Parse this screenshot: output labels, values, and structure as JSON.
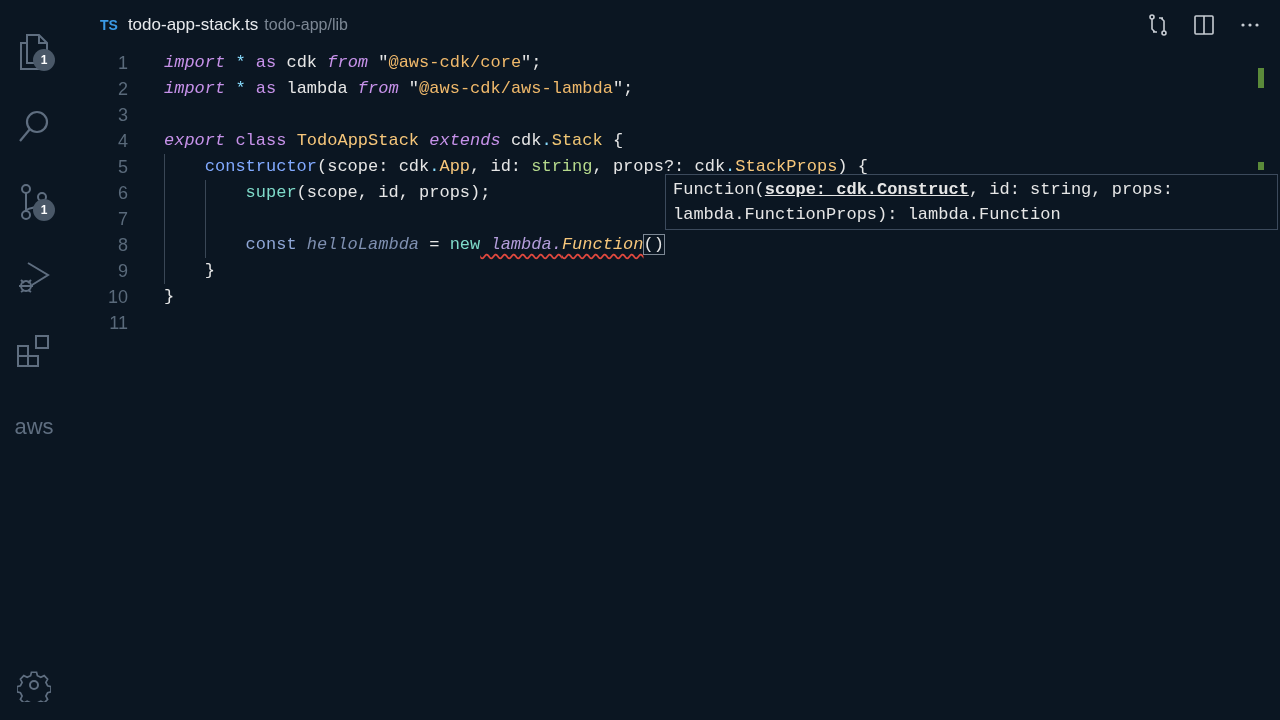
{
  "activity_bar": {
    "items": [
      {
        "kind": "files",
        "badge": "1"
      },
      {
        "kind": "search"
      },
      {
        "kind": "branch",
        "badge": "1"
      },
      {
        "kind": "debug"
      },
      {
        "kind": "extensions"
      },
      {
        "kind": "logo",
        "label": "aws"
      }
    ]
  },
  "editor_header": {
    "file_type": "TS",
    "file_name": "todo-app-stack.ts",
    "path": "todo-app/lib"
  },
  "code_lines": [
    {
      "number": "1",
      "tokens": [
        {
          "kind": "keyword-italic",
          "text": "import"
        },
        {
          "kind": "operator",
          "text": " *"
        },
        {
          "kind": "keyword",
          "text": " as"
        },
        {
          "kind": "plain",
          "text": " cdk "
        },
        {
          "kind": "keyword-italic",
          "text": "from"
        },
        {
          "kind": "plain",
          "text": " \""
        },
        {
          "kind": "string",
          "text": "@aws-cdk/core"
        },
        {
          "kind": "plain",
          "text": "\";"
        }
      ]
    },
    {
      "number": "2",
      "tokens": [
        {
          "kind": "keyword-italic",
          "text": "import"
        },
        {
          "kind": "operator",
          "text": " *"
        },
        {
          "kind": "keyword",
          "text": " as"
        },
        {
          "kind": "plain",
          "text": " lambda "
        },
        {
          "kind": "keyword-italic",
          "text": "from"
        },
        {
          "kind": "plain",
          "text": " \""
        },
        {
          "kind": "string",
          "text": "@aws-cdk/aws-lambda"
        },
        {
          "kind": "plain",
          "text": "\";"
        }
      ]
    },
    {
      "number": "3"
    },
    {
      "number": "4",
      "tokens": [
        {
          "kind": "keyword-italic",
          "text": "export"
        },
        {
          "kind": "keyword",
          "text": " class"
        },
        {
          "kind": "class",
          "text": " TodoAppStack"
        },
        {
          "kind": "keyword-italic",
          "text": " extends"
        },
        {
          "kind": "plain",
          "text": " cdk"
        },
        {
          "kind": "operator",
          "text": "."
        },
        {
          "kind": "type",
          "text": "Stack"
        },
        {
          "kind": "plain",
          "text": " {"
        }
      ]
    },
    {
      "number": "5",
      "tokens": [
        {
          "kind": "function",
          "text": "    constructor"
        },
        {
          "kind": "plain",
          "text": "(scope: cdk"
        },
        {
          "kind": "operator",
          "text": "."
        },
        {
          "kind": "class",
          "text": "App"
        },
        {
          "kind": "plain",
          "text": ", id: "
        },
        {
          "kind": "primitive",
          "text": "string"
        },
        {
          "kind": "plain",
          "text": ", props?: cdk"
        },
        {
          "kind": "operator",
          "text": "."
        },
        {
          "kind": "class",
          "text": "StackProps"
        },
        {
          "kind": "plain",
          "text": ") {"
        }
      ]
    },
    {
      "number": "6",
      "tokens": [
        {
          "kind": "builtin",
          "text": "        super"
        },
        {
          "kind": "plain",
          "text": "(scope, id, props);"
        }
      ]
    },
    {
      "number": "7"
    },
    {
      "number": "8",
      "tokens": [
        {
          "kind": "storage",
          "text": "        const"
        },
        {
          "kind": "variable",
          "text": " helloLambda"
        },
        {
          "kind": "plain",
          "text": " = "
        },
        {
          "kind": "builtin",
          "text": "new"
        },
        {
          "kind": "namespace",
          "text": " lambda.",
          "error": true
        },
        {
          "kind": "class-italic",
          "text": "Function",
          "error": true
        },
        {
          "kind": "plain",
          "text": "()",
          "matched_bracket": true
        }
      ]
    },
    {
      "number": "9",
      "tokens": [
        {
          "kind": "plain",
          "text": "    }"
        }
      ]
    },
    {
      "number": "10",
      "tokens": [
        {
          "kind": "plain",
          "text": "}"
        }
      ]
    },
    {
      "number": "11"
    }
  ],
  "signature_help": {
    "text": "Function(**scope: cdk.Construct**, id: string, props: lambda.FunctionProps): lambda.Function"
  }
}
